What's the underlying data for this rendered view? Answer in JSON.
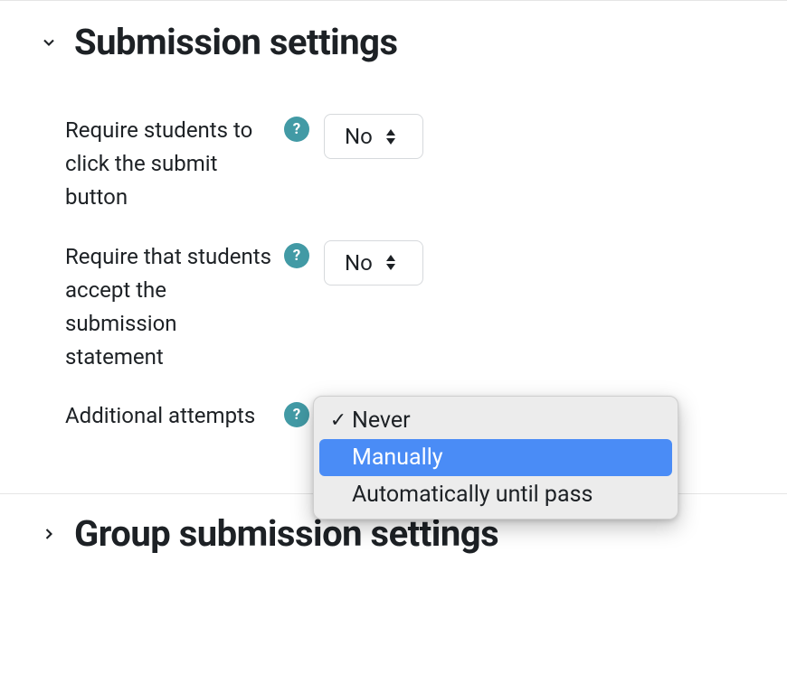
{
  "sections": {
    "submission": {
      "title": "Submission settings",
      "expanded": true,
      "fields": {
        "require_submit_button": {
          "label": "Require students to click the submit button",
          "value": "No"
        },
        "require_submission_statement": {
          "label": "Require that students accept the submission statement",
          "value": "No"
        },
        "additional_attempts": {
          "label": "Additional attempts",
          "value": "Never",
          "options": [
            "Never",
            "Manually",
            "Automatically until pass"
          ],
          "highlighted_option": "Manually",
          "dropdown_open": true
        }
      }
    },
    "group_submission": {
      "title": "Group submission settings",
      "expanded": false
    }
  },
  "icons": {
    "help_glyph": "?",
    "check_glyph": "✓"
  }
}
